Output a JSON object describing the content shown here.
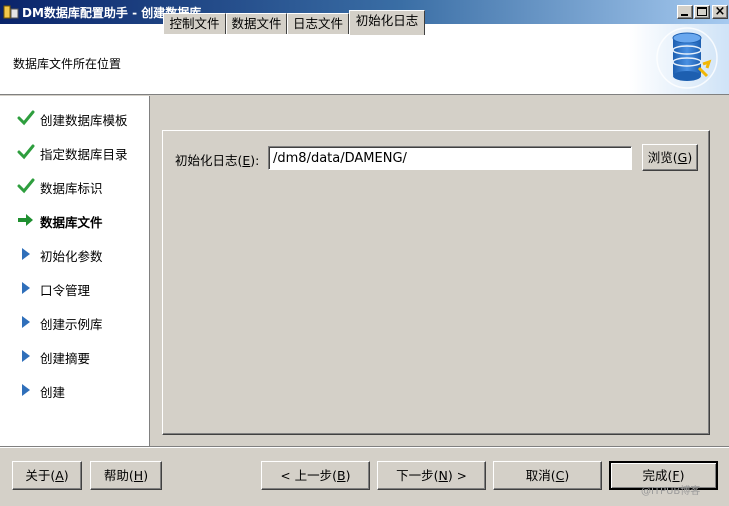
{
  "window": {
    "title": "DM数据库配置助手 - 创建数据库",
    "controls": [
      "minimize",
      "maximize",
      "close"
    ]
  },
  "header": {
    "page_title": "数据库文件所在位置",
    "logo_icon": "database-gear-icon"
  },
  "steps": [
    {
      "label": "创建数据库模板",
      "state": "done",
      "icon": "check-icon"
    },
    {
      "label": "指定数据库目录",
      "state": "done",
      "icon": "check-icon"
    },
    {
      "label": "数据库标识",
      "state": "done",
      "icon": "check-icon"
    },
    {
      "label": "数据库文件",
      "state": "current",
      "icon": "arrow-right-icon"
    },
    {
      "label": "初始化参数",
      "state": "pending",
      "icon": "triangle-right-icon"
    },
    {
      "label": "口令管理",
      "state": "pending",
      "icon": "triangle-right-icon"
    },
    {
      "label": "创建示例库",
      "state": "pending",
      "icon": "triangle-right-icon"
    },
    {
      "label": "创建摘要",
      "state": "pending",
      "icon": "triangle-right-icon"
    },
    {
      "label": "创建",
      "state": "pending",
      "icon": "triangle-right-icon"
    }
  ],
  "tabs": [
    {
      "label": "控制文件",
      "active": false
    },
    {
      "label": "数据文件",
      "active": false
    },
    {
      "label": "日志文件",
      "active": false
    },
    {
      "label": "初始化日志",
      "active": true
    }
  ],
  "init_log": {
    "label_text": "初始化日志(",
    "label_mnemonic": "E",
    "label_suffix": "):",
    "path_value": "/dm8/data/DAMENG/",
    "browse": {
      "text": "浏览(",
      "mnemonic": "G",
      "suffix": ")"
    }
  },
  "buttons": {
    "about": {
      "text": "关于(",
      "mnemonic": "A",
      "suffix": ")"
    },
    "help": {
      "text": "帮助(",
      "mnemonic": "H",
      "suffix": ")"
    },
    "prev": {
      "arrow": "<",
      "text": "上一步(",
      "mnemonic": "B",
      "suffix": ")"
    },
    "next": {
      "arrow": ">",
      "text": "下一步(",
      "mnemonic": "N",
      "suffix": ")"
    },
    "cancel": {
      "text": "取消(",
      "mnemonic": "C",
      "suffix": ")"
    },
    "finish": {
      "text": "完成(",
      "mnemonic": "F",
      "suffix": ")"
    }
  },
  "watermark": "@ITPUB博客",
  "colors": {
    "titlebar_start": "#0a246a",
    "titlebar_end": "#a6caf0",
    "face": "#d4d0c8",
    "done_check": "#2e9e3e",
    "current_arrow": "#1f8f30",
    "pending_triangle": "#2f6fba"
  }
}
